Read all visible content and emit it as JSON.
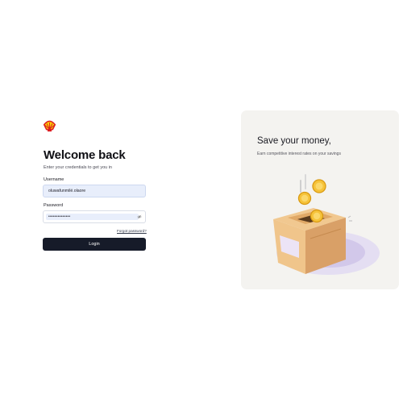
{
  "brand": {
    "logo_icon": "shell-logo-icon"
  },
  "login": {
    "title": "Welcome back",
    "subtitle": "Enter your credentials to get you in",
    "username_label": "Username",
    "username_value": "oluwafunmilé.olaore",
    "password_label": "Password",
    "password_masked": "••••••••••••••",
    "password_toggle_icon": "eye-off-icon",
    "forgot_password": "Forgot password?",
    "submit_label": "Login"
  },
  "promo": {
    "title": "Save your money,",
    "subtitle": "Earn competitive interest rates on your savings",
    "illustration": "savings-box-coins-illustration"
  },
  "colors": {
    "accent_dark": "#161b29",
    "input_fill": "#e8eefb",
    "panel_bg": "#f4f3f0",
    "shell_yellow": "#fbce07",
    "shell_red": "#dd1d21"
  }
}
